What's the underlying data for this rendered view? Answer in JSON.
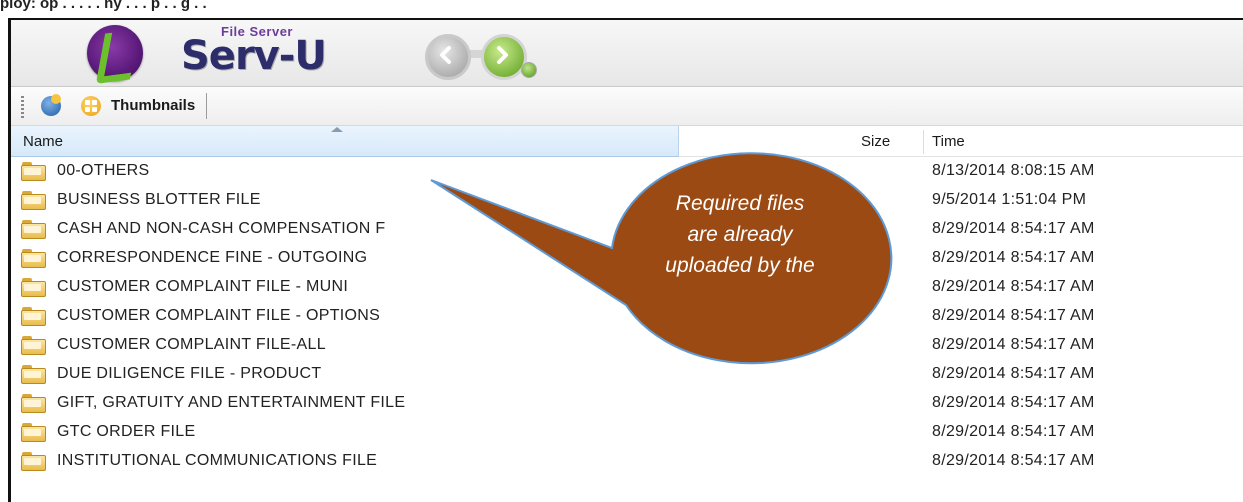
{
  "page_caption": "ploy: op . . . . . ny . . . p . . g . .",
  "header": {
    "logo_small": "File Server",
    "logo_big": "Serv-U"
  },
  "toolbar": {
    "thumbnails_label": "Thumbnails"
  },
  "columns": {
    "name": "Name",
    "size": "Size",
    "time": "Time"
  },
  "rows": [
    {
      "name": "00-OTHERS",
      "size": "",
      "time": "8/13/2014 8:08:15 AM"
    },
    {
      "name": "BUSINESS BLOTTER FILE",
      "size": "",
      "time": "9/5/2014 1:51:04 PM"
    },
    {
      "name": "CASH AND NON-CASH COMPENSATION F",
      "size": "",
      "time": "8/29/2014 8:54:17 AM"
    },
    {
      "name": "CORRESPONDENCE FINE - OUTGOING",
      "size": "",
      "time": "8/29/2014 8:54:17 AM"
    },
    {
      "name": "CUSTOMER COMPLAINT FILE - MUNI",
      "size": "",
      "time": "8/29/2014 8:54:17 AM"
    },
    {
      "name": "CUSTOMER COMPLAINT FILE - OPTIONS",
      "size": "",
      "time": "8/29/2014 8:54:17 AM"
    },
    {
      "name": "CUSTOMER COMPLAINT FILE-ALL",
      "size": "",
      "time": "8/29/2014 8:54:17 AM"
    },
    {
      "name": "DUE DILIGENCE FILE - PRODUCT",
      "size": "",
      "time": "8/29/2014 8:54:17 AM"
    },
    {
      "name": "GIFT, GRATUITY AND ENTERTAINMENT FILE",
      "size": "",
      "time": "8/29/2014 8:54:17 AM"
    },
    {
      "name": "GTC ORDER FILE",
      "size": "",
      "time": "8/29/2014 8:54:17 AM"
    },
    {
      "name": "INSTITUTIONAL COMMUNICATIONS FILE",
      "size": "",
      "time": "8/29/2014 8:54:17 AM"
    }
  ],
  "callout": {
    "lines": [
      "Required files",
      "are already",
      "uploaded by the"
    ],
    "fill": "#9c4a14",
    "stroke": "#5e9bd6"
  },
  "colors": {
    "header_bg": "#ebebeb",
    "column_header_bg": "#dcecfb",
    "logo_purple": "#5a1a7a",
    "logo_green": "#6cc02d"
  }
}
